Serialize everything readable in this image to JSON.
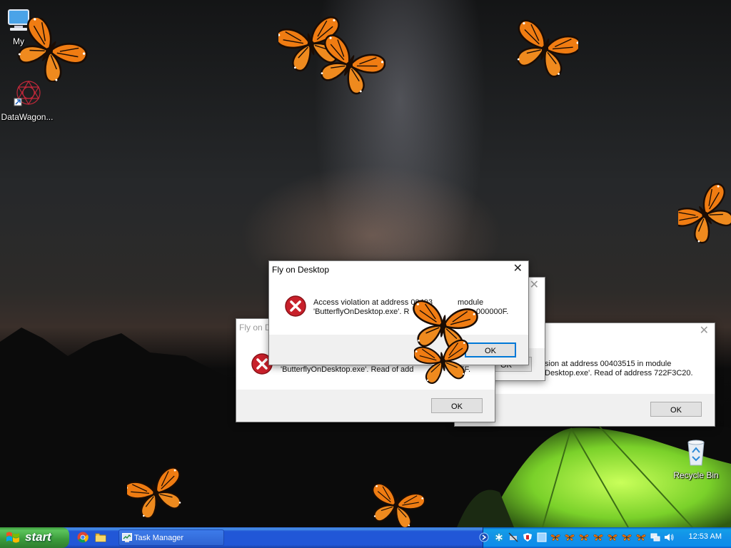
{
  "desktop": {
    "icons": [
      {
        "label": "My",
        "icon": "computer-icon"
      },
      {
        "label": "DataWagon...",
        "icon": "datawagon-shortcut-icon"
      },
      {
        "label": "Recycle Bin",
        "icon": "recycle-bin-icon"
      }
    ]
  },
  "dialogs": {
    "front": {
      "title": "Fly on Desktop",
      "line1": "Access violation at address 00403",
      "line1_right": " module",
      "line2": "'ButterflyOnDesktop.exe'. R",
      "line2_right": "000000F.",
      "ok_label": "OK"
    },
    "behind_right": {
      "line1": "sion at address 00403515 in module",
      "line2": "Desktop.exe'. Read of address 722F3C20.",
      "ok_label": "OK"
    },
    "behind_left": {
      "title": "Fly on D",
      "line2_left": "'ButterflyOnDesktop.exe'. Read of add",
      "line2_right": "FFF.",
      "ok_label": "OK"
    },
    "behind_mid": {
      "ok_label": "OK"
    }
  },
  "taskbar": {
    "start_label": "start",
    "quick_launch": [
      "chrome-icon",
      "folder-icon"
    ],
    "task_button_label": "Task Manager",
    "clock": "12:53 AM"
  },
  "colors": {
    "taskbar_blue": "#2157d7",
    "start_green": "#3a9a3a",
    "tray_blue": "#1290e8",
    "error_red": "#c8202a",
    "butterfly_orange": "#f07c12"
  }
}
